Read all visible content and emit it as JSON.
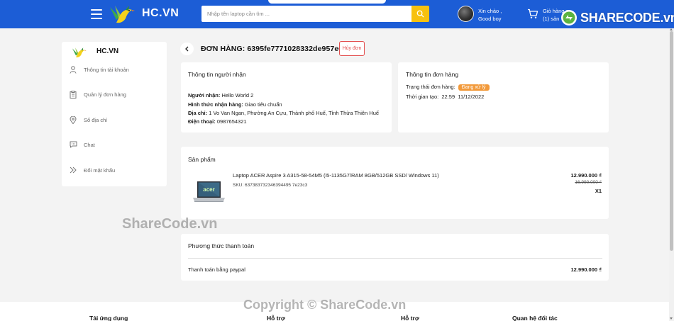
{
  "header": {
    "brand": "HC.VN",
    "search_placeholder": "Nhập tên laptop cần tìm ...",
    "greeting_line1": "Xin chào ,",
    "greeting_line2": "Good boy",
    "cart_line1": "Giỏ hàng c",
    "cart_line2": "(1) sản",
    "watermark_logo": "SHARECODE.vn",
    "colors": {
      "bar": "#1c5dd6",
      "search_button": "#f7c10f"
    }
  },
  "sidebar": {
    "brand": "HC.VN",
    "items": [
      {
        "label": "Thông tin tài khoản",
        "icon": "user-icon"
      },
      {
        "label": "Quản lý đơn hàng",
        "icon": "clipboard-icon"
      },
      {
        "label": "Sổ địa chỉ",
        "icon": "location-pin-icon"
      },
      {
        "label": "Chat",
        "icon": "chat-bubble-icon"
      },
      {
        "label": "Đổi mật khẩu",
        "icon": "double-chevron-right-icon"
      }
    ]
  },
  "order": {
    "title": "ĐƠN HÀNG: 6395fe7771028332de957e68",
    "cancel_label": "Hủy đơn"
  },
  "recipient": {
    "heading": "Thông tin người nhận",
    "name_label": "Người nhận:",
    "name_value": "Hello World 2",
    "method_label": "Hình thức nhận hàng:",
    "method_value": "Giao tiêu chuẩn",
    "address_label": "Địa chỉ:",
    "address_value": "1 Vo Van Ngan, Phường An Cựu, Thành phố Huế, Tỉnh Thừa Thiên Huế",
    "phone_label": "Điện thoại:",
    "phone_value": "0987654321"
  },
  "order_info": {
    "heading": "Thông tin đơn hàng",
    "status_label": "Trạng thái đơn hàng:",
    "status_value": "Đang xử lý",
    "time_label": "Thời gian tạo:",
    "time_value": "22:59",
    "date_value": "11/12/2022",
    "status_color": "#f29a3b"
  },
  "products": {
    "heading": "Sản phẩm",
    "items": [
      {
        "name": "Laptop ACER Aspire 3 A315-58-54M5 (i5-1135G7/RAM 8GB/512GB SSD/ Windows 11)",
        "sku": "SKU: 637383732346394495 7e23c3",
        "price": "12.990.000 ₫",
        "old_price": "16.990.000 ₫",
        "quantity": "X1",
        "image_text": "acer"
      }
    ]
  },
  "payment": {
    "heading": "Phương thức thanh toán",
    "method": "Thanh toán bằng paypal",
    "total": "12.990.000 ₫"
  },
  "footer": {
    "columns": [
      "Tải ứng dụng",
      "Hỗ trợ",
      "Hỗ trợ",
      "Quan hệ đối tác"
    ]
  },
  "watermarks": {
    "mid": "ShareCode.vn",
    "bottom": "Copyright © ShareCode.vn"
  }
}
